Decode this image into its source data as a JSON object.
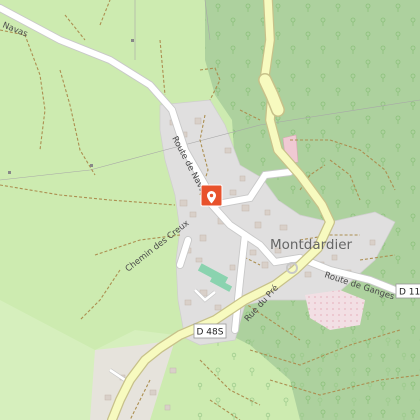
{
  "map": {
    "place_label": "Montdardier",
    "marker_icon": "location-pin-icon",
    "colors": {
      "meadow": "#cdebb0",
      "forest": "#add19e",
      "residential": "#e0dfdf",
      "primary_road": "#f7fabf",
      "road_casing": "#c7c18a",
      "marker": "#e8522c",
      "track": "#ac8f51"
    },
    "road_labels": {
      "navas": "Navas",
      "route_de_navas": "Route de Navas",
      "chemin_des_creux": "Chemin des Creux",
      "rue_du_pre": "Rue du Pré",
      "route_de_ganges": "Route de Ganges"
    },
    "shields": {
      "d485": "D 48S",
      "d11": "D 11"
    }
  }
}
